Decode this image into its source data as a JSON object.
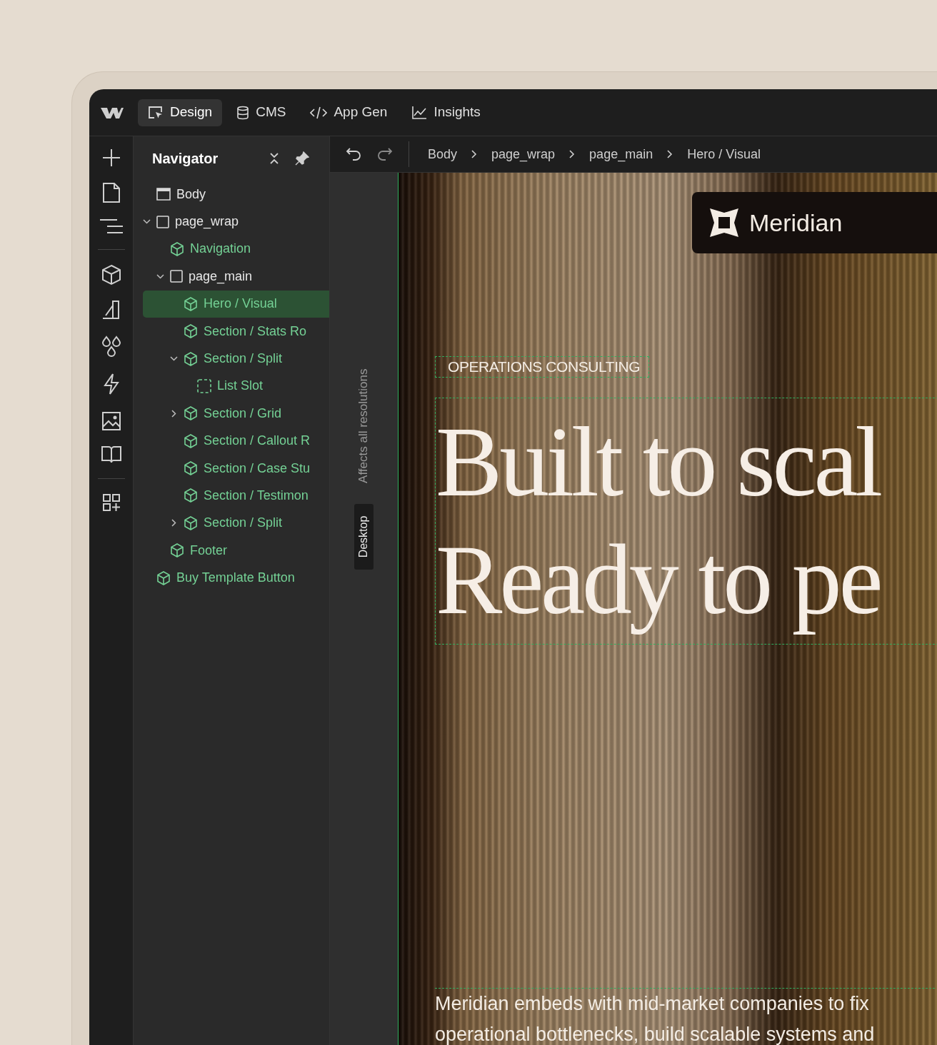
{
  "top_tabs": [
    {
      "label": "Design",
      "selected": true
    },
    {
      "label": "CMS",
      "selected": false
    },
    {
      "label": "App Gen",
      "selected": false
    },
    {
      "label": "Insights",
      "selected": false
    }
  ],
  "navigator": {
    "title": "Navigator",
    "tree": [
      {
        "label": "Body",
        "kind": "body",
        "selected": false
      },
      {
        "label": "page_wrap",
        "kind": "element",
        "selected": false,
        "expanded": true,
        "children": [
          {
            "label": "Navigation",
            "kind": "component",
            "selected": false
          },
          {
            "label": "page_main",
            "kind": "element",
            "selected": false,
            "expanded": true,
            "children": [
              {
                "label": "Hero / Visual",
                "kind": "component",
                "selected": true
              },
              {
                "label": "Section / Stats Ro",
                "kind": "component",
                "selected": false
              },
              {
                "label": "Section / Split",
                "kind": "component",
                "selected": false,
                "expanded": true,
                "children": [
                  {
                    "label": "List Slot",
                    "kind": "slot",
                    "selected": false
                  }
                ]
              },
              {
                "label": "Section / Grid",
                "kind": "component",
                "selected": false,
                "expanded": false
              },
              {
                "label": "Section / Callout R",
                "kind": "component",
                "selected": false
              },
              {
                "label": "Section / Case Stu",
                "kind": "component",
                "selected": false
              },
              {
                "label": "Section / Testimon",
                "kind": "component",
                "selected": false
              },
              {
                "label": "Section / Split",
                "kind": "component",
                "selected": false,
                "expanded": false
              }
            ]
          },
          {
            "label": "Footer",
            "kind": "component",
            "selected": false
          }
        ]
      },
      {
        "label": "Buy Template Button",
        "kind": "component",
        "selected": false
      }
    ]
  },
  "breadcrumb": [
    "Body",
    "page_wrap",
    "page_main",
    "Hero / Visual"
  ],
  "breakpoint_strip": {
    "note": "Affects all resolutions",
    "tab": "Desktop"
  },
  "hero": {
    "brand": "Meridian",
    "eyebrow": "OPERATIONS CONSULTING",
    "headline": [
      "Built to scal",
      "Ready to pe"
    ],
    "paragraph": "Meridian embeds with mid-market companies to fix operational bottlenecks, build scalable systems and"
  }
}
